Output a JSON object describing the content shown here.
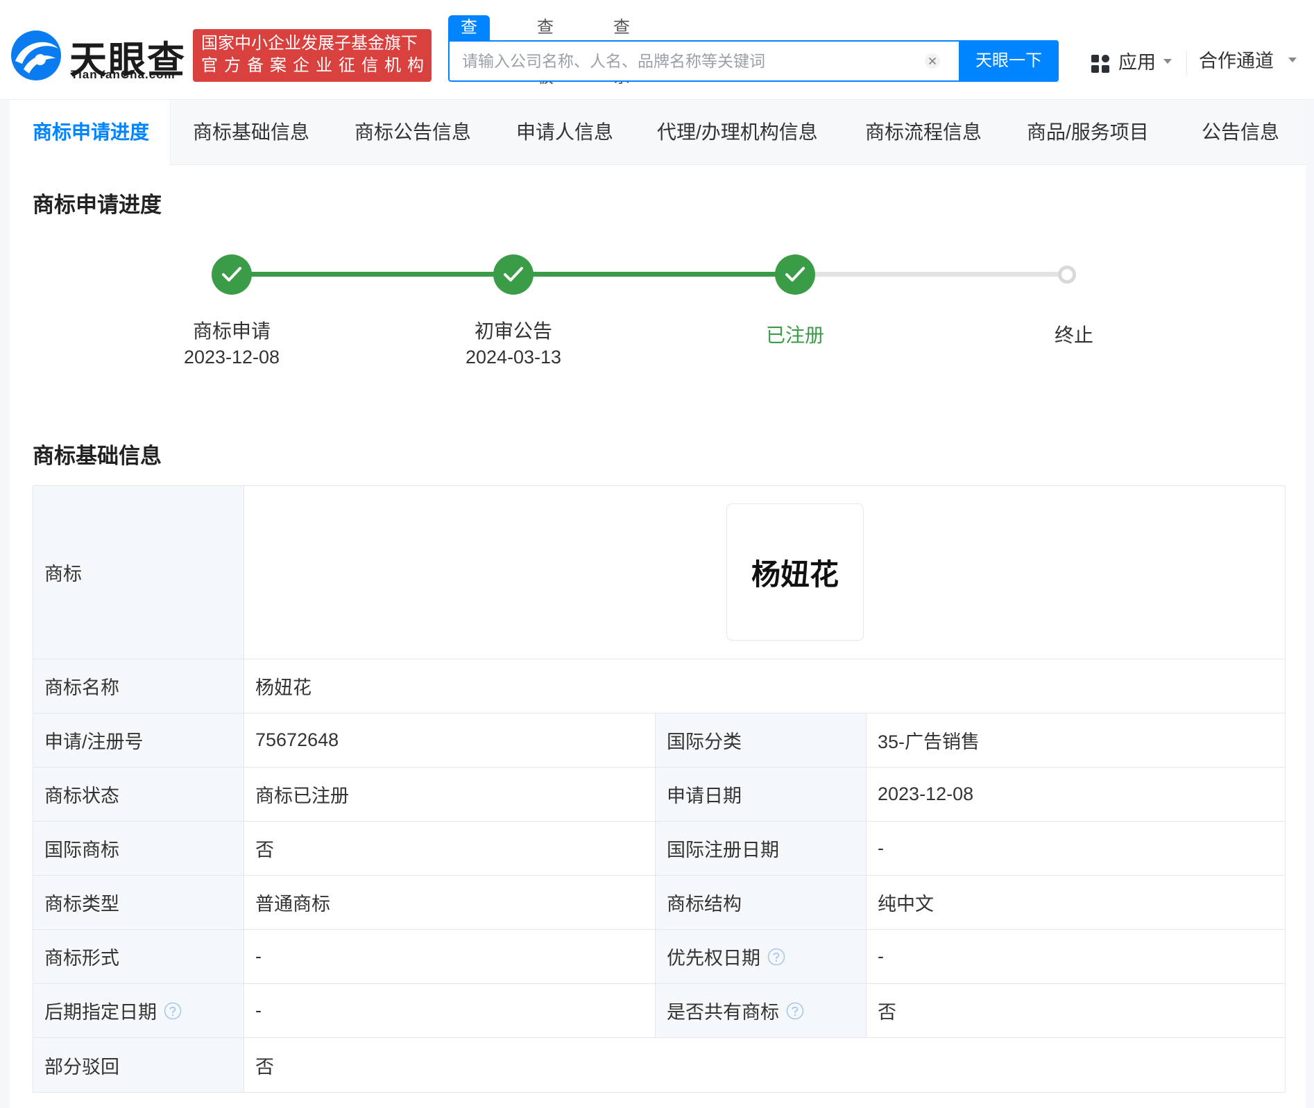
{
  "header": {
    "logo_text": "天眼查",
    "logo_sub": "TianYanCha.com",
    "badge_line1": "国家中小企业发展子基金旗下",
    "badge_line2": "官方备案企业征信机构",
    "search_tabs": [
      "查公司",
      "查老板",
      "查关系"
    ],
    "search_placeholder": "请输入公司名称、人名、品牌名称等关键词",
    "search_button": "天眼一下",
    "apps_label": "应用",
    "coop_label": "合作通道"
  },
  "nav": {
    "items": [
      "商标申请进度",
      "商标基础信息",
      "商标公告信息",
      "申请人信息",
      "代理/办理机构信息",
      "商标流程信息",
      "商品/服务项目",
      "公告信息"
    ],
    "active_index": 0
  },
  "progress": {
    "title": "商标申请进度",
    "steps": [
      {
        "label": "商标申请",
        "date": "2023-12-08",
        "status": "done"
      },
      {
        "label": "初审公告",
        "date": "2024-03-13",
        "status": "done"
      },
      {
        "label": "已注册",
        "date": "",
        "status": "current"
      },
      {
        "label": "终止",
        "date": "",
        "status": "pending"
      }
    ],
    "colors": {
      "done": "#3b9c48",
      "pending": "#d8d8d8"
    }
  },
  "basic_info": {
    "title": "商标基础信息",
    "trademark_label": "商标",
    "trademark_image_text": "杨妞花",
    "name_label": "商标名称",
    "name_value": "杨妞花",
    "rows": [
      {
        "l1": "申请/注册号",
        "v1": "75672648",
        "l2": "国际分类",
        "v2": "35-广告销售"
      },
      {
        "l1": "商标状态",
        "v1": "商标已注册",
        "l2": "申请日期",
        "v2": "2023-12-08"
      },
      {
        "l1": "国际商标",
        "v1": "否",
        "l2": "国际注册日期",
        "v2": "-"
      },
      {
        "l1": "商标类型",
        "v1": "普通商标",
        "l2": "商标结构",
        "v2": "纯中文"
      },
      {
        "l1": "商标形式",
        "v1": "-",
        "l2": "优先权日期",
        "v2": "-"
      },
      {
        "l1": "后期指定日期",
        "v1": "-",
        "l2": "是否共有商标",
        "v2": "否"
      }
    ],
    "last_label": "部分驳回",
    "last_value": "否"
  }
}
